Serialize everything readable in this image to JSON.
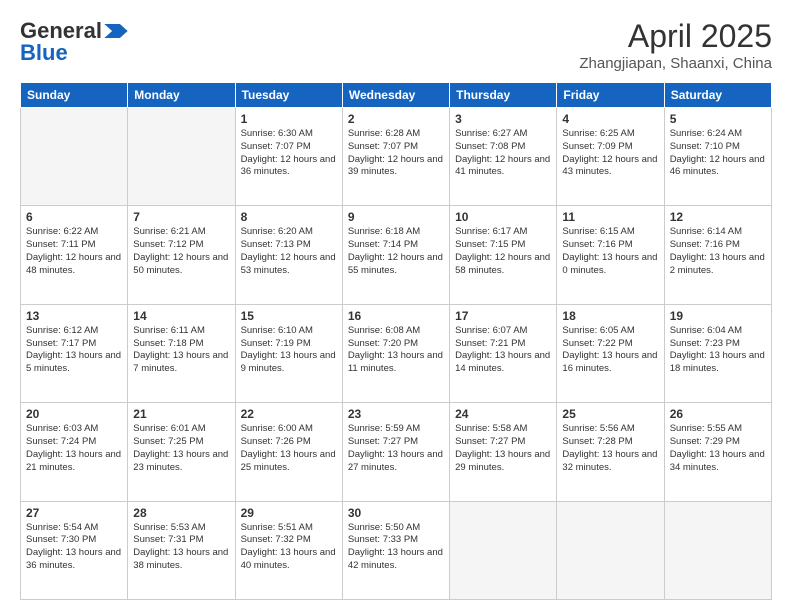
{
  "header": {
    "logo_line1": "General",
    "logo_line2": "Blue",
    "month": "April 2025",
    "location": "Zhangjiapan, Shaanxi, China"
  },
  "weekdays": [
    "Sunday",
    "Monday",
    "Tuesday",
    "Wednesday",
    "Thursday",
    "Friday",
    "Saturday"
  ],
  "weeks": [
    [
      {
        "day": "",
        "info": ""
      },
      {
        "day": "",
        "info": ""
      },
      {
        "day": "1",
        "info": "Sunrise: 6:30 AM\nSunset: 7:07 PM\nDaylight: 12 hours and 36 minutes."
      },
      {
        "day": "2",
        "info": "Sunrise: 6:28 AM\nSunset: 7:07 PM\nDaylight: 12 hours and 39 minutes."
      },
      {
        "day": "3",
        "info": "Sunrise: 6:27 AM\nSunset: 7:08 PM\nDaylight: 12 hours and 41 minutes."
      },
      {
        "day": "4",
        "info": "Sunrise: 6:25 AM\nSunset: 7:09 PM\nDaylight: 12 hours and 43 minutes."
      },
      {
        "day": "5",
        "info": "Sunrise: 6:24 AM\nSunset: 7:10 PM\nDaylight: 12 hours and 46 minutes."
      }
    ],
    [
      {
        "day": "6",
        "info": "Sunrise: 6:22 AM\nSunset: 7:11 PM\nDaylight: 12 hours and 48 minutes."
      },
      {
        "day": "7",
        "info": "Sunrise: 6:21 AM\nSunset: 7:12 PM\nDaylight: 12 hours and 50 minutes."
      },
      {
        "day": "8",
        "info": "Sunrise: 6:20 AM\nSunset: 7:13 PM\nDaylight: 12 hours and 53 minutes."
      },
      {
        "day": "9",
        "info": "Sunrise: 6:18 AM\nSunset: 7:14 PM\nDaylight: 12 hours and 55 minutes."
      },
      {
        "day": "10",
        "info": "Sunrise: 6:17 AM\nSunset: 7:15 PM\nDaylight: 12 hours and 58 minutes."
      },
      {
        "day": "11",
        "info": "Sunrise: 6:15 AM\nSunset: 7:16 PM\nDaylight: 13 hours and 0 minutes."
      },
      {
        "day": "12",
        "info": "Sunrise: 6:14 AM\nSunset: 7:16 PM\nDaylight: 13 hours and 2 minutes."
      }
    ],
    [
      {
        "day": "13",
        "info": "Sunrise: 6:12 AM\nSunset: 7:17 PM\nDaylight: 13 hours and 5 minutes."
      },
      {
        "day": "14",
        "info": "Sunrise: 6:11 AM\nSunset: 7:18 PM\nDaylight: 13 hours and 7 minutes."
      },
      {
        "day": "15",
        "info": "Sunrise: 6:10 AM\nSunset: 7:19 PM\nDaylight: 13 hours and 9 minutes."
      },
      {
        "day": "16",
        "info": "Sunrise: 6:08 AM\nSunset: 7:20 PM\nDaylight: 13 hours and 11 minutes."
      },
      {
        "day": "17",
        "info": "Sunrise: 6:07 AM\nSunset: 7:21 PM\nDaylight: 13 hours and 14 minutes."
      },
      {
        "day": "18",
        "info": "Sunrise: 6:05 AM\nSunset: 7:22 PM\nDaylight: 13 hours and 16 minutes."
      },
      {
        "day": "19",
        "info": "Sunrise: 6:04 AM\nSunset: 7:23 PM\nDaylight: 13 hours and 18 minutes."
      }
    ],
    [
      {
        "day": "20",
        "info": "Sunrise: 6:03 AM\nSunset: 7:24 PM\nDaylight: 13 hours and 21 minutes."
      },
      {
        "day": "21",
        "info": "Sunrise: 6:01 AM\nSunset: 7:25 PM\nDaylight: 13 hours and 23 minutes."
      },
      {
        "day": "22",
        "info": "Sunrise: 6:00 AM\nSunset: 7:26 PM\nDaylight: 13 hours and 25 minutes."
      },
      {
        "day": "23",
        "info": "Sunrise: 5:59 AM\nSunset: 7:27 PM\nDaylight: 13 hours and 27 minutes."
      },
      {
        "day": "24",
        "info": "Sunrise: 5:58 AM\nSunset: 7:27 PM\nDaylight: 13 hours and 29 minutes."
      },
      {
        "day": "25",
        "info": "Sunrise: 5:56 AM\nSunset: 7:28 PM\nDaylight: 13 hours and 32 minutes."
      },
      {
        "day": "26",
        "info": "Sunrise: 5:55 AM\nSunset: 7:29 PM\nDaylight: 13 hours and 34 minutes."
      }
    ],
    [
      {
        "day": "27",
        "info": "Sunrise: 5:54 AM\nSunset: 7:30 PM\nDaylight: 13 hours and 36 minutes."
      },
      {
        "day": "28",
        "info": "Sunrise: 5:53 AM\nSunset: 7:31 PM\nDaylight: 13 hours and 38 minutes."
      },
      {
        "day": "29",
        "info": "Sunrise: 5:51 AM\nSunset: 7:32 PM\nDaylight: 13 hours and 40 minutes."
      },
      {
        "day": "30",
        "info": "Sunrise: 5:50 AM\nSunset: 7:33 PM\nDaylight: 13 hours and 42 minutes."
      },
      {
        "day": "",
        "info": ""
      },
      {
        "day": "",
        "info": ""
      },
      {
        "day": "",
        "info": ""
      }
    ]
  ]
}
